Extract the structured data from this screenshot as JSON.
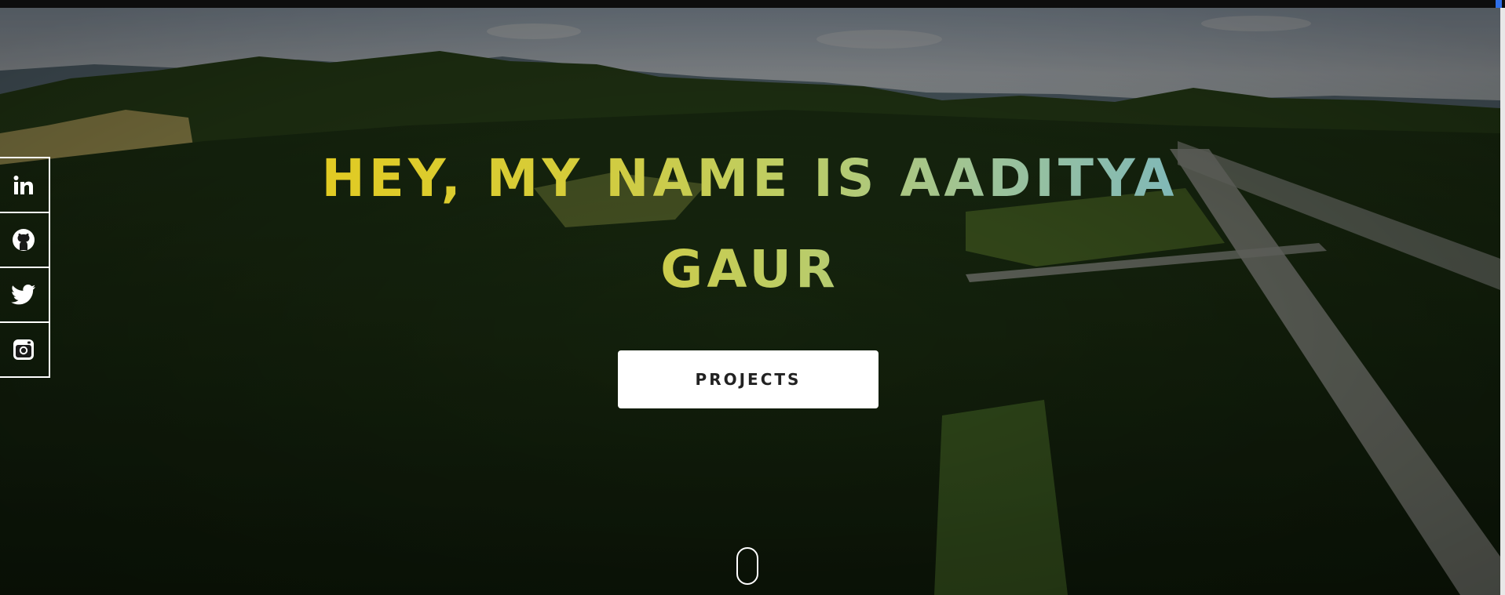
{
  "hero": {
    "headline_line1": "HEY, MY NAME IS AADITYA",
    "headline_line2": "GAUR",
    "projects_label": "PROJECTS",
    "gradient": [
      "#e2cb22",
      "#bccd66",
      "#7fb8b9"
    ]
  },
  "social": {
    "items": [
      {
        "name": "LinkedIn",
        "icon": "linkedin-icon"
      },
      {
        "name": "GitHub",
        "icon": "github-icon"
      },
      {
        "name": "Twitter",
        "icon": "twitter-icon"
      },
      {
        "name": "Instagram",
        "icon": "instagram-icon"
      }
    ]
  },
  "scroll": {
    "icon": "mouse-scroll-icon"
  }
}
